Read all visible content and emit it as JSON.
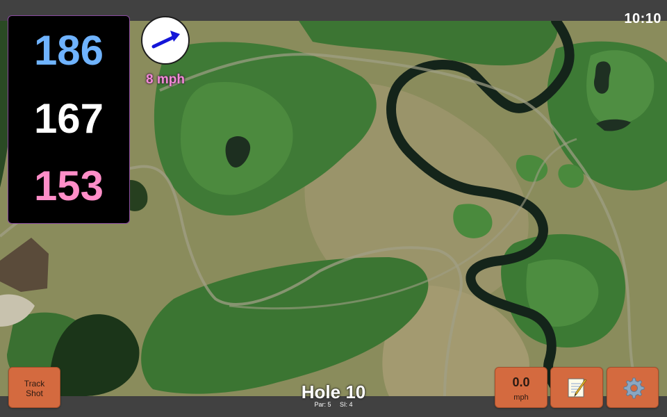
{
  "status": {
    "time": "10:10"
  },
  "distances": {
    "back": "186",
    "middle": "167",
    "front": "153"
  },
  "wind": {
    "speed_label": "8 mph",
    "direction_icon": "arrow-right-up-icon"
  },
  "track_button": {
    "line1": "Track",
    "line2": "Shot"
  },
  "speed_button": {
    "value": "0.0",
    "unit": "mph"
  },
  "notes_button": {
    "icon": "notepad-icon"
  },
  "settings_button": {
    "icon": "gear-icon"
  },
  "hole": {
    "title": "Hole 10",
    "par": "Par: 5",
    "si": "SI: 4"
  },
  "colors": {
    "back": "#6fb3ff",
    "middle": "#ffffff",
    "front": "#ff8ec8",
    "wind_text": "#f28ad6",
    "button": "#d46a3f",
    "bar": "#414141"
  }
}
